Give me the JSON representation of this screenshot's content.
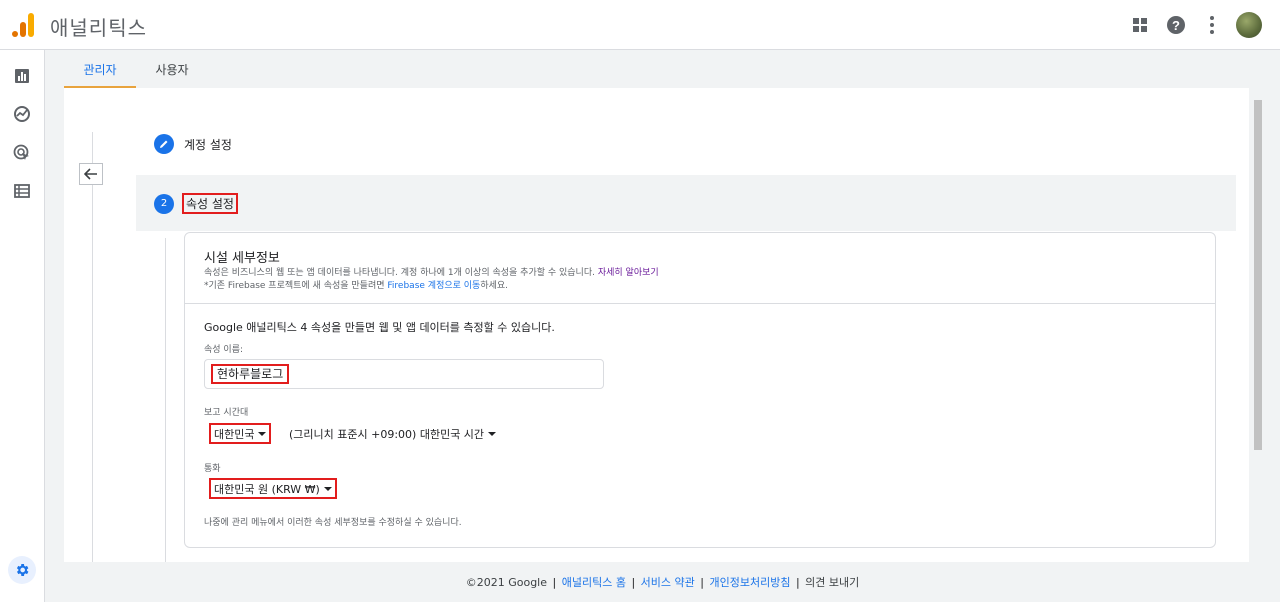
{
  "app": {
    "title": "애널리틱스"
  },
  "tabs": [
    {
      "label": "관리자"
    },
    {
      "label": "사용자"
    }
  ],
  "steps": [
    {
      "number": "✎",
      "label": "계정 설정"
    },
    {
      "number": "2",
      "label": "속성 설정"
    }
  ],
  "property_details": {
    "title": "시설 세부정보",
    "desc_text": "속성은 비즈니스의 웹 또는 앱 데이터를 나타냅니다. 계정 하나에 1개 이상의 속성을 추가할 수 있습니다.",
    "desc_link": "자세히 알아보기",
    "firebase_prefix": "*기존 Firebase 프로젝트에 새 속성을 만들려면",
    "firebase_link": "Firebase 계정으로 이동",
    "firebase_suffix": "하세요.",
    "intro": "Google 애널리틱스 4 속성을 만들면 웹 및 앱 데이터를 측정할 수 있습니다.",
    "name_label": "속성 이름:",
    "name_value": "현하루블로그",
    "timezone_label": "보고 시간대",
    "timezone_country": "대한민국",
    "timezone_zone": "(그리니치 표준시 +09:00) 대한민국 시간",
    "currency_label": "통화",
    "currency_value": "대한민국 원 (KRW ₩)",
    "note": "나중에 관리 메뉴에서 이러한 속성 세부정보를 수정하실 수 있습니다."
  },
  "footer": {
    "copyright": "©2021 Google",
    "home": "애널리틱스 홈",
    "terms": "서비스 약관",
    "privacy": "개인정보처리방침",
    "feedback": "의견 보내기",
    "separator": "|"
  },
  "colors": {
    "accent": "#1a73e8",
    "highlight": "#e21d1d",
    "tab_underline": "#e8a33d"
  },
  "icons": [
    "apps-grid-icon",
    "help-icon",
    "more-vert-icon",
    "reports-icon",
    "explore-icon",
    "advertising-icon",
    "configure-icon",
    "settings-icon",
    "arrow-back-icon",
    "edit-icon"
  ]
}
